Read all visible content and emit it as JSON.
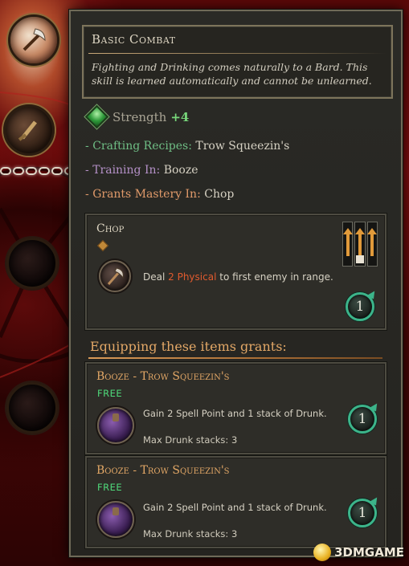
{
  "skill": {
    "title": "Basic Combat",
    "description": "Fighting and Drinking comes naturally to a Bard.  This skill is learned automatically and cannot be unlearned."
  },
  "stat": {
    "name": "Strength",
    "value": "+4"
  },
  "details": [
    {
      "key": "Crafting Recipes:",
      "value": "Trow Squeezin's"
    },
    {
      "key": "Training In:",
      "value": "Booze"
    },
    {
      "key": "Grants Mastery In:",
      "value": "Chop"
    }
  ],
  "ability": {
    "name": "Chop",
    "text_before": "Deal",
    "damage": "2 Physical",
    "text_after": "to first enemy in range.",
    "cooldown": "1"
  },
  "equip": {
    "heading": "Equipping these items grants:",
    "items": [
      {
        "title": "Booze - Trow Squeezin's",
        "cost": "FREE",
        "effect": "Gain 2 Spell Point and 1 stack of Drunk.",
        "note": "Max Drunk stacks: 3",
        "cooldown": "1"
      },
      {
        "title": "Booze - Trow Squeezin's",
        "cost": "FREE",
        "effect": "Gain 2 Spell Point and 1 stack of Drunk.",
        "note": "Max Drunk stacks: 3",
        "cooldown": "1"
      }
    ]
  },
  "watermark": {
    "text": "3DMGAME"
  },
  "colors": {
    "stat_value": "#77d67a",
    "crafting": "#6fbe85",
    "training": "#b591c8",
    "mastery": "#e09a6a",
    "physical": "#e05a2e",
    "free": "#4fd97a",
    "cooldown_ring": "#3cb48a",
    "item_title": "#e2a766"
  },
  "icons": {
    "skill_node": "axe-icon",
    "strength": "green-gem-icon",
    "chop": "chop-icon",
    "chop_range": "range-grid-icon",
    "cooldown": "cooldown-icon",
    "booze": "potion-icon"
  }
}
